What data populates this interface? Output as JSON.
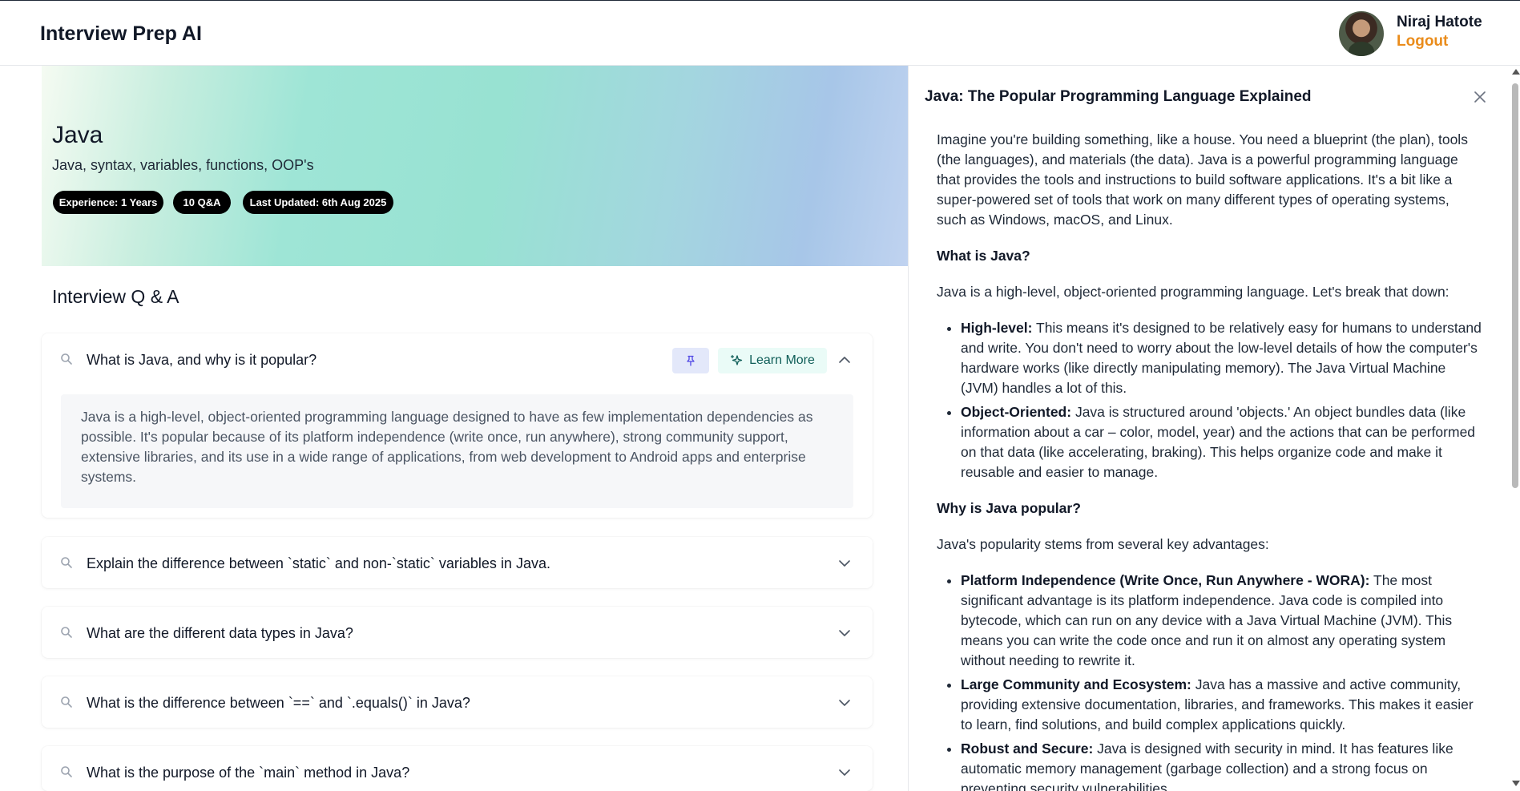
{
  "header": {
    "app_title": "Interview Prep AI",
    "user_name": "Niraj Hatote",
    "logout_label": "Logout"
  },
  "hero": {
    "title": "Java",
    "topics": "Java, syntax, variables, functions, OOP's",
    "pills": [
      "Experience: 1 Years",
      "10 Q&A",
      "Last Updated: 6th Aug 2025"
    ]
  },
  "qa": {
    "section_title": "Interview Q & A",
    "learn_more_label": "Learn More",
    "questions": [
      {
        "q": "What is Java, and why is it popular?",
        "expanded": true,
        "answer": "Java is a high-level, object-oriented programming language designed to have as few implementation dependencies as possible. It's popular because of its platform independence (write once, run anywhere), strong community support, extensive libraries, and its use in a wide range of applications, from web development to Android apps and enterprise systems."
      },
      {
        "q": "Explain the difference between `static` and non-`static` variables in Java.",
        "expanded": false
      },
      {
        "q": "What are the different data types in Java?",
        "expanded": false
      },
      {
        "q": "What is the difference between `==` and `.equals()` in Java?",
        "expanded": false
      },
      {
        "q": "What is the purpose of the `main` method in Java?",
        "expanded": false
      }
    ]
  },
  "drawer": {
    "title": "Java: The Popular Programming Language Explained",
    "intro": "Imagine you're building something, like a house. You need a blueprint (the plan), tools (the languages), and materials (the data). Java is a powerful programming language that provides the tools and instructions to build software applications. It's a bit like a super-powered set of tools that work on many different types of operating systems, such as Windows, macOS, and Linux.",
    "h1": "What is Java?",
    "p1": "Java is a high-level, object-oriented programming language. Let's break that down:",
    "list1": [
      {
        "term": "High-level:",
        "text": " This means it's designed to be relatively easy for humans to understand and write. You don't need to worry about the low-level details of how the computer's hardware works (like directly manipulating memory). The Java Virtual Machine (JVM) handles a lot of this."
      },
      {
        "term": "Object-Oriented:",
        "text": " Java is structured around 'objects.' An object bundles data (like information about a car – color, model, year) and the actions that can be performed on that data (like accelerating, braking). This helps organize code and make it reusable and easier to manage."
      }
    ],
    "h2": "Why is Java popular?",
    "p2": "Java's popularity stems from several key advantages:",
    "list2": [
      {
        "term": "Platform Independence (Write Once, Run Anywhere - WORA):",
        "text": " The most significant advantage is its platform independence. Java code is compiled into bytecode, which can run on any device with a Java Virtual Machine (JVM). This means you can write the code once and run it on almost any operating system without needing to rewrite it."
      },
      {
        "term": "Large Community and Ecosystem:",
        "text": " Java has a massive and active community, providing extensive documentation, libraries, and frameworks. This makes it easier to learn, find solutions, and build complex applications quickly."
      },
      {
        "term": "Robust and Secure:",
        "text": " Java is designed with security in mind. It has features like automatic memory management (garbage collection) and a strong focus on preventing security vulnerabilities."
      }
    ]
  },
  "colors": {
    "accent_logout": "#ea8c1b",
    "learn_more_bg": "#eafbf7",
    "pin_bg": "#e3e8fa",
    "pill_bg": "#000000"
  },
  "icons": [
    "search-icon",
    "pin-icon",
    "sparkle-icon",
    "chevron-up-icon",
    "chevron-down-icon",
    "close-icon"
  ]
}
